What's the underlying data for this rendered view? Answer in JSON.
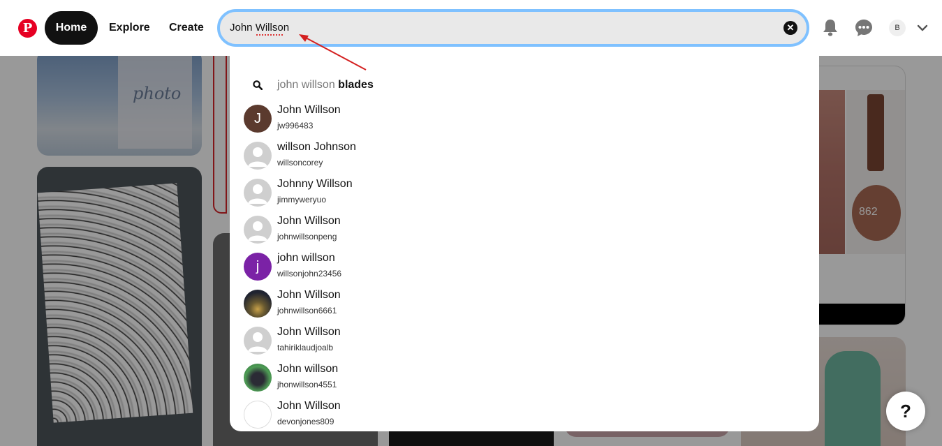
{
  "header": {
    "nav": {
      "home": "Home",
      "explore": "Explore",
      "create": "Create"
    },
    "search": {
      "value": "John Willson",
      "clear_glyph": "✕"
    },
    "account_initial": "B",
    "icons": {
      "logo": "pinterest-logo",
      "notifications": "bell-icon",
      "messages": "chat-icon",
      "account_menu": "chevron-down-icon",
      "clear": "close-icon"
    }
  },
  "dropdown": {
    "suggestion": {
      "typed": "john willson",
      "completion": " blades",
      "icon": "search-icon"
    },
    "users": [
      {
        "name": "John Willson",
        "handle": "jw996483",
        "avatar": "letter",
        "letter": "J",
        "color": "#5b3a2e"
      },
      {
        "name": "willson Johnson",
        "handle": "willsoncorey",
        "avatar": "default"
      },
      {
        "name": "Johnny Willson",
        "handle": "jimmyweryuo",
        "avatar": "default"
      },
      {
        "name": "John Willson",
        "handle": "johnwillsonpeng",
        "avatar": "default"
      },
      {
        "name": "john willson",
        "handle": "willsonjohn23456",
        "avatar": "letter",
        "letter": "j",
        "color": "#7b22a6"
      },
      {
        "name": "John Willson",
        "handle": "johnwillson6661",
        "avatar": "photo-night"
      },
      {
        "name": "John Willson",
        "handle": "tahiriklaudjoalb",
        "avatar": "default"
      },
      {
        "name": "John willson",
        "handle": "jhonwillson4551",
        "avatar": "photo-dog"
      },
      {
        "name": "John Willson",
        "handle": "devonjones809",
        "avatar": "broken"
      }
    ]
  },
  "background": {
    "photo_word": "photo",
    "product_label": "862"
  },
  "help": {
    "label": "?"
  },
  "colors": {
    "brand": "#e60023",
    "search_focus": "#7fc1ff",
    "annotation_arrow": "#d42020"
  }
}
